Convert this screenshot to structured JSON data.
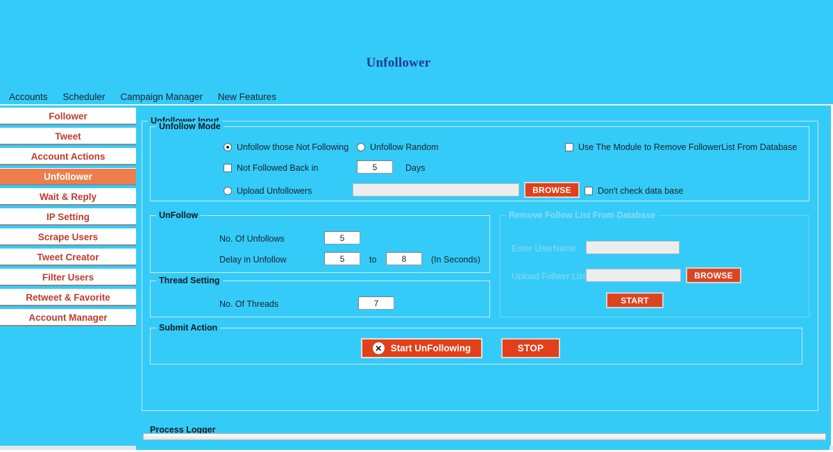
{
  "window": {
    "title": "Unfollower",
    "title_color": "#1F3A8C",
    "background_color": "#35CBF8",
    "accent_color": "#E2401A",
    "selected_color": "#EE7E4B",
    "sidebar_text_color": "#C0392B"
  },
  "menubar": {
    "items": [
      {
        "label": "Accounts"
      },
      {
        "label": "Scheduler"
      },
      {
        "label": "Campaign Manager"
      },
      {
        "label": "New Features"
      }
    ]
  },
  "sidebar": {
    "items": [
      {
        "label": "Follower",
        "selected": false
      },
      {
        "label": "Tweet",
        "selected": false
      },
      {
        "label": "Account Actions",
        "selected": false
      },
      {
        "label": "Unfollower",
        "selected": true
      },
      {
        "label": "Wait & Reply",
        "selected": false
      },
      {
        "label": "IP  Setting",
        "selected": false
      },
      {
        "label": "Scrape Users",
        "selected": false
      },
      {
        "label": "Tweet Creator",
        "selected": false
      },
      {
        "label": "Filter Users",
        "selected": false
      },
      {
        "label": "Retweet & Favorite",
        "selected": false
      },
      {
        "label": "Account Manager",
        "selected": false
      }
    ]
  },
  "main": {
    "input_group_legend": "Unfollower Input",
    "unfollow_mode": {
      "legend": "Unfollow Mode",
      "radio_not_following_label": "Unfollow those Not Following",
      "radio_not_following_checked": true,
      "radio_random_label": "Unfollow Random",
      "radio_random_checked": false,
      "checkbox_not_followed_back_label": "Not Followed Back in",
      "checkbox_not_followed_back_checked": false,
      "days_value": "5",
      "days_unit_label": "Days",
      "radio_upload_label": "Upload Unfollowers",
      "radio_upload_checked": false,
      "upload_path_value": "",
      "upload_path_placeholder": "",
      "browse_label": "BROWSE",
      "checkbox_dont_check_db_label": "Don't check data base",
      "checkbox_dont_check_db_checked": false,
      "checkbox_use_module_label": "Use The Module to Remove FollowerList From Database",
      "checkbox_use_module_checked": false
    },
    "unfollow": {
      "legend": "UnFollow",
      "no_of_unfollows_label": "No. Of Unfollows",
      "no_of_unfollows_value": "5",
      "delay_label": "Delay in Unfollow",
      "delay_from_value": "5",
      "delay_to_label": "to",
      "delay_to_value": "8",
      "seconds_label": "(In Seconds)"
    },
    "thread_setting": {
      "legend": "Thread Setting",
      "no_of_threads_label": "No. Of Threads",
      "no_of_threads_value": "7"
    },
    "remove_db": {
      "legend": "Remove Follow List From Database",
      "enabled": false,
      "username_label": "Enter UserName",
      "username_value": "",
      "upload_list_label": "Upload Follwer List",
      "upload_list_value": "",
      "browse_label": "BROWSE",
      "start_label": "START"
    },
    "submit_action": {
      "legend": "Submit Action",
      "start_icon": "x-circle-icon",
      "start_label": "Start UnFollowing",
      "stop_label": "STOP"
    },
    "process_logger": {
      "legend": "Process Logger",
      "content": ""
    }
  }
}
